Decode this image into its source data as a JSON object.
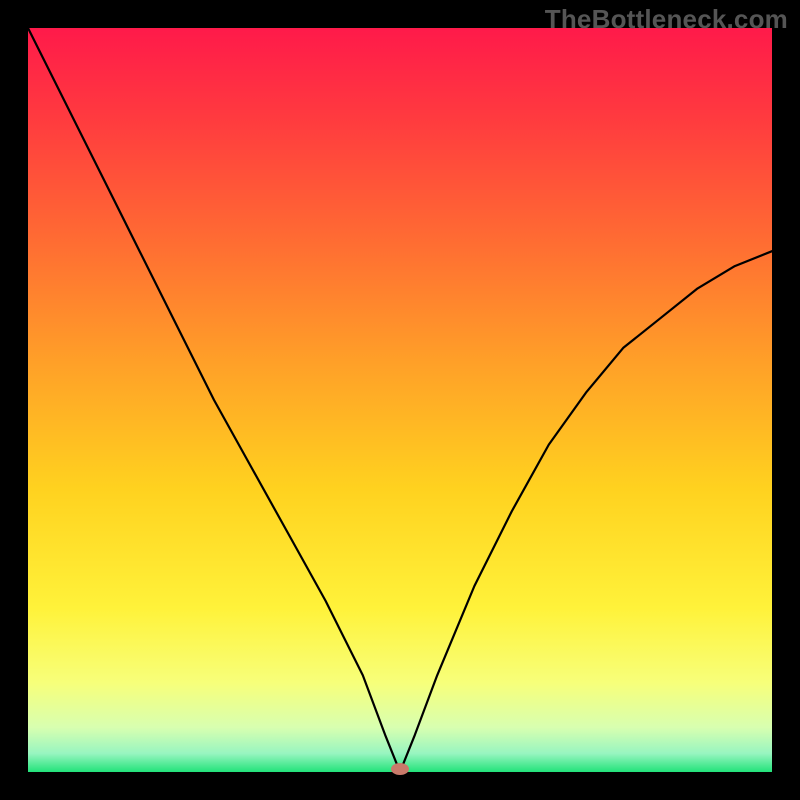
{
  "watermark": "TheBottleneck.com",
  "chart_data": {
    "type": "line",
    "title": "",
    "xlabel": "",
    "ylabel": "",
    "xlim": [
      0,
      100
    ],
    "ylim": [
      0,
      100
    ],
    "x": [
      0,
      5,
      10,
      15,
      20,
      25,
      30,
      35,
      40,
      45,
      48,
      50,
      52,
      55,
      60,
      65,
      70,
      75,
      80,
      85,
      90,
      95,
      100
    ],
    "values": [
      100,
      90,
      80,
      70,
      60,
      50,
      41,
      32,
      23,
      13,
      5,
      0,
      5,
      13,
      25,
      35,
      44,
      51,
      57,
      61,
      65,
      68,
      70
    ],
    "minimum_marker": {
      "x": 50,
      "y": 0
    },
    "background": "rainbow_vertical_gradient",
    "frame_color": "#000000"
  }
}
